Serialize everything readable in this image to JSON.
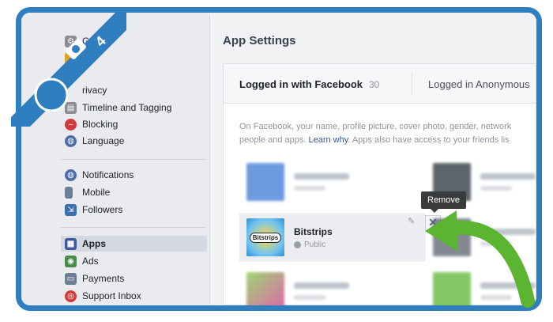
{
  "sidebar": {
    "items": [
      {
        "label": "G",
        "icon": "gear-icon",
        "color": "#8a8d91"
      },
      {
        "label": "",
        "icon": "lock-icon",
        "color": "#e0a526"
      },
      {
        "label": "rivacy",
        "icon": "privacy-icon",
        "color": "#6c7a93"
      },
      {
        "label": "Timeline and Tagging",
        "icon": "timeline-icon",
        "color": "#8a8d91"
      },
      {
        "label": "Blocking",
        "icon": "blocking-icon",
        "color": "#d33a3a"
      },
      {
        "label": "Language",
        "icon": "globe-icon",
        "color": "#4b6ea9"
      },
      {
        "label": "Notifications",
        "icon": "globe-icon",
        "color": "#4b6ea9"
      },
      {
        "label": "Mobile",
        "icon": "mobile-icon",
        "color": "#6b7f99"
      },
      {
        "label": "Followers",
        "icon": "followers-icon",
        "color": "#3b6fb0"
      },
      {
        "label": "Apps",
        "icon": "apps-icon",
        "color": "#3b5998"
      },
      {
        "label": "Ads",
        "icon": "ads-icon",
        "color": "#4a8a4a"
      },
      {
        "label": "Payments",
        "icon": "payments-icon",
        "color": "#6d7f95"
      },
      {
        "label": "Support Inbox",
        "icon": "support-icon",
        "color": "#d33a3a"
      }
    ]
  },
  "badge": {
    "number": "4",
    "icon": "camera-icon"
  },
  "main": {
    "title": "App Settings",
    "tabs": [
      {
        "label": "Logged in with Facebook",
        "count": "30"
      },
      {
        "label": "Logged in Anonymous"
      }
    ],
    "description_line1": "On Facebook, your name, profile picture, cover photo, gender, network",
    "description_line2_before": "people and apps.",
    "learn_why": "Learn why",
    "description_line2_after": ". Apps also have access to your friends lis",
    "app": {
      "name": "Bitstrips",
      "privacy": "Public",
      "logo_text": "Bitstrips"
    },
    "tooltip": "Remove",
    "remove_symbol": "✕",
    "edit_symbol": "✎"
  },
  "colors": {
    "accent": "#2f7fc0",
    "arrow": "#5cb531",
    "link": "#365899"
  }
}
